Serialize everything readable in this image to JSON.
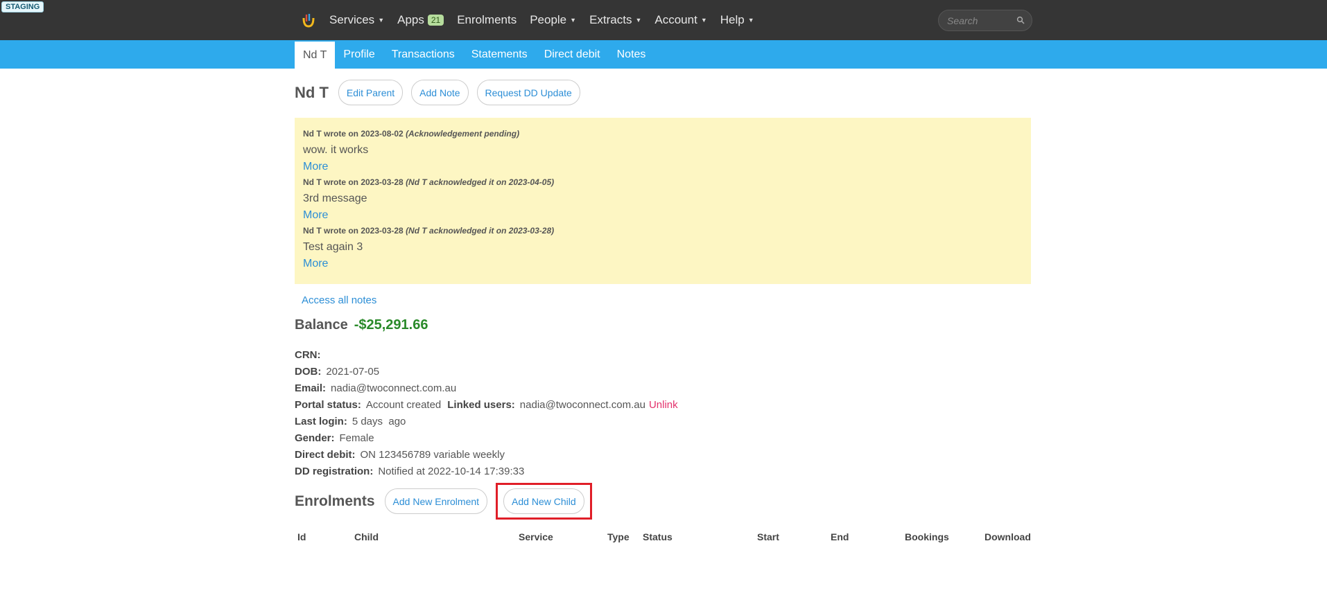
{
  "env_badge": "STAGING",
  "topnav": {
    "items": [
      {
        "label": "Services",
        "caret": true
      },
      {
        "label": "Apps",
        "badge": "21"
      },
      {
        "label": "Enrolments"
      },
      {
        "label": "People",
        "caret": true
      },
      {
        "label": "Extracts",
        "caret": true
      },
      {
        "label": "Account",
        "caret": true
      },
      {
        "label": "Help",
        "caret": true
      }
    ],
    "search_placeholder": "Search"
  },
  "subnav": {
    "tabs": [
      "Nd T",
      "Profile",
      "Transactions",
      "Statements",
      "Direct debit",
      "Notes"
    ],
    "active": "Nd T"
  },
  "page": {
    "title": "Nd T",
    "buttons": {
      "edit_parent": "Edit Parent",
      "add_note": "Add Note",
      "request_dd": "Request DD Update"
    }
  },
  "notes": [
    {
      "head": "Nd T wrote on 2023-08-02",
      "ack": "(Acknowledgement pending)",
      "body": "wow. it works",
      "more": "More"
    },
    {
      "head": "Nd T wrote on 2023-03-28",
      "ack": "(Nd T acknowledged it on 2023-04-05)",
      "body": "3rd message",
      "more": "More"
    },
    {
      "head": "Nd T wrote on 2023-03-28",
      "ack": "(Nd T acknowledged it on 2023-03-28)",
      "body": "Test again 3",
      "more": "More"
    }
  ],
  "access_all_notes": "Access all notes",
  "balance": {
    "label": "Balance",
    "value": "-$25,291.66"
  },
  "details": {
    "crn": {
      "label": "CRN:",
      "value": ""
    },
    "dob": {
      "label": "DOB:",
      "value": "2021-07-05"
    },
    "email": {
      "label": "Email:",
      "value": "nadia@twoconnect.com.au"
    },
    "portal": {
      "label": "Portal status:",
      "value": "Account created",
      "linked_label": "Linked users:",
      "linked_value": "nadia@twoconnect.com.au",
      "unlink": "Unlink"
    },
    "last_login": {
      "label": "Last login:",
      "value": "5 days  ago"
    },
    "gender": {
      "label": "Gender:",
      "value": "Female"
    },
    "direct_debit": {
      "label": "Direct debit:",
      "value": "ON 123456789 variable weekly"
    },
    "dd_registration": {
      "label": "DD registration:",
      "value": "Notified at 2022-10-14 17:39:33"
    }
  },
  "enrolments": {
    "title": "Enrolments",
    "add_enrolment": "Add New Enrolment",
    "add_child": "Add New Child",
    "columns": [
      "Id",
      "Child",
      "Service",
      "Type",
      "Status",
      "Start",
      "End",
      "Bookings",
      "Download"
    ]
  },
  "colors": {
    "topbar": "#353535",
    "subnav": "#2eaaec",
    "notes_bg": "#fdf6c3",
    "link": "#2c8ed6",
    "balance": "#2a8a2a",
    "unlink": "#e3306b",
    "highlight": "#e01e28"
  }
}
